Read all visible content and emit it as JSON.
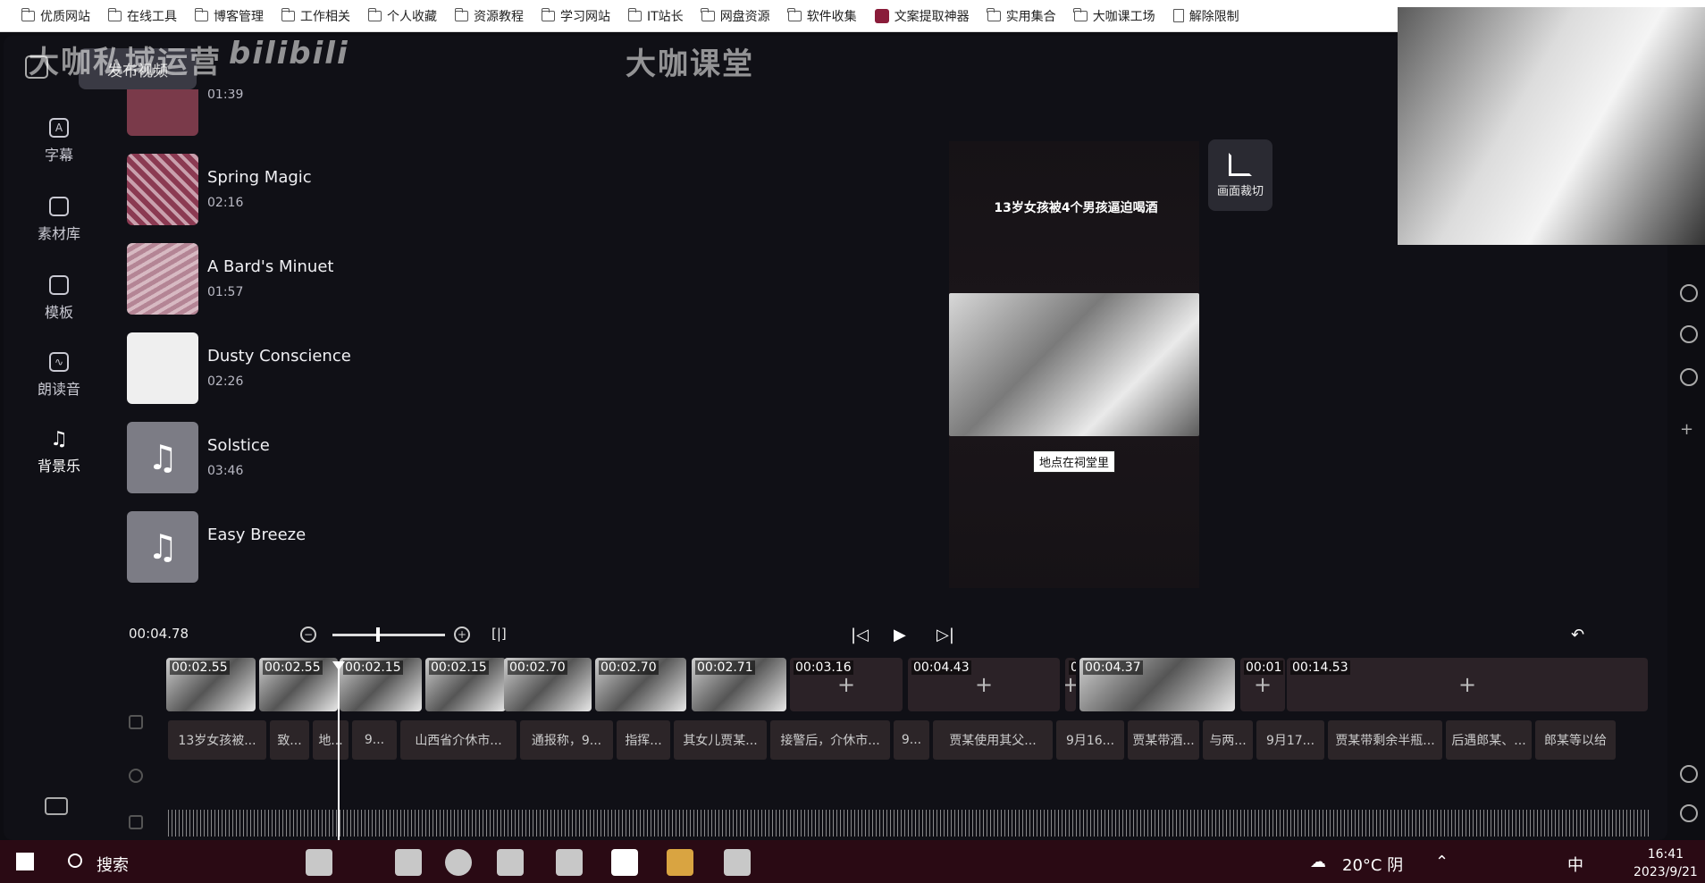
{
  "bookmarks": [
    "优质网站",
    "在线工具",
    "博客管理",
    "工作相关",
    "个人收藏",
    "资源教程",
    "学习网站",
    "IT站长",
    "网盘资源",
    "软件收集",
    "文案提取神器",
    "实用集合",
    "大咖课工场",
    "解除限制"
  ],
  "header": {
    "publish": "发布视频",
    "watermark_left": "大咖私域运营",
    "watermark_brand": "bilibili",
    "watermark_center": "大咖课堂"
  },
  "sidebar": [
    {
      "label": "字幕",
      "icon": "subtitle-icon"
    },
    {
      "label": "素材库",
      "icon": "library-icon"
    },
    {
      "label": "模板",
      "icon": "template-icon"
    },
    {
      "label": "朗读音",
      "icon": "voice-icon"
    },
    {
      "label": "背景乐",
      "icon": "music-icon"
    }
  ],
  "music": [
    {
      "name": "",
      "duration": "01:39"
    },
    {
      "name": "Spring Magic",
      "duration": "02:16"
    },
    {
      "name": "A Bard's Minuet",
      "duration": "01:57"
    },
    {
      "name": "Dusty Conscience",
      "duration": "02:26"
    },
    {
      "name": "Solstice",
      "duration": "03:46"
    },
    {
      "name": "Easy Breeze",
      "duration": ""
    }
  ],
  "preview": {
    "title": "13岁女孩被4个男孩逼迫喝酒",
    "subtitle": "地点在祠堂里",
    "crop_label": "画面裁切"
  },
  "controls": {
    "current_time": "00:04.78",
    "zoom": 0.42
  },
  "clips": [
    {
      "label": "00:02.55",
      "kind": "img"
    },
    {
      "label": "00:02.55",
      "kind": "img"
    },
    {
      "label": "00:02.15",
      "kind": "img"
    },
    {
      "label": "00:02.15",
      "kind": "img"
    },
    {
      "label": "00:02.70",
      "kind": "img"
    },
    {
      "label": "00:02.70",
      "kind": "img"
    },
    {
      "label": "00:02.71",
      "kind": "img"
    },
    {
      "label": "00:03.16",
      "kind": "empty"
    },
    {
      "label": "00:04.43",
      "kind": "empty"
    },
    {
      "label": "0",
      "kind": "empty"
    },
    {
      "label": "00:04.37",
      "kind": "img"
    },
    {
      "label": "00:01",
      "kind": "empty"
    },
    {
      "label": "00:14.53",
      "kind": "empty"
    }
  ],
  "subtitles": [
    "13岁女孩被...",
    "致...",
    "地...",
    "9...",
    "山西省介休市...",
    "通报称，9...",
    "指挥...",
    "其女儿贾某...",
    "接警后，介休市...",
    "9...",
    "贾某使用其父...",
    "9月16...",
    "贾某带酒...",
    "与两...",
    "9月17...",
    "贾某带剩余半瓶...",
    "后遇郎某、...",
    "郎某等以给"
  ],
  "taskbar": {
    "search": "搜索",
    "weather": "20°C 阴",
    "ime": "中",
    "time": "16:41",
    "date": "2023/9/21"
  }
}
